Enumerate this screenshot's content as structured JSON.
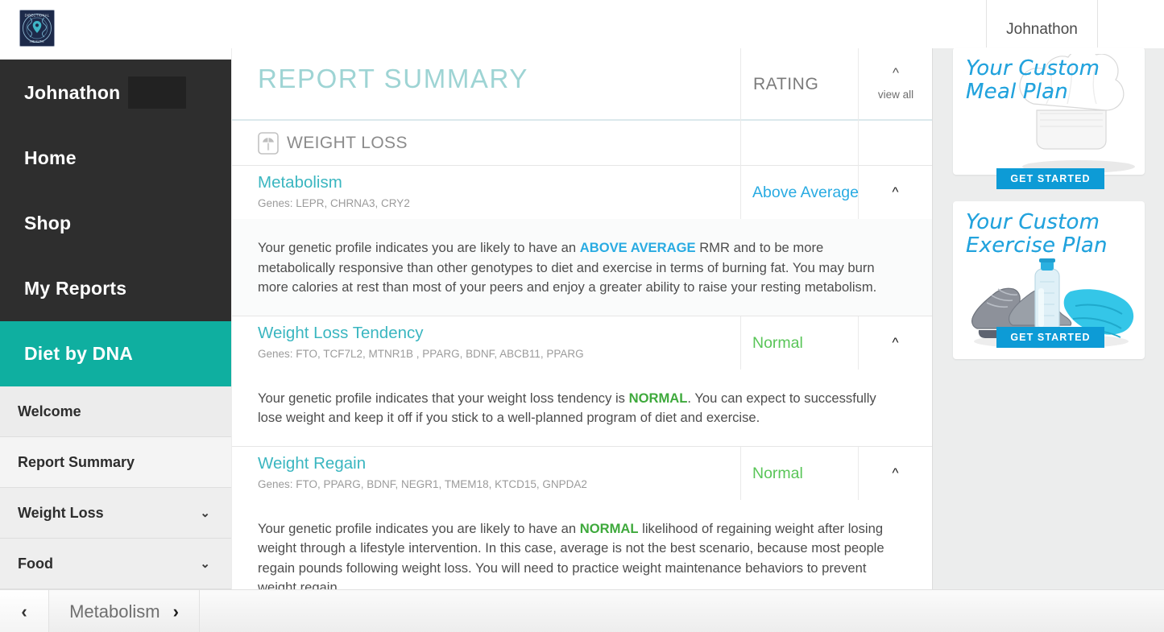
{
  "topbar": {
    "logo_alt": "DIRECTIONAL HEALTH",
    "logo_text_top": "DIRECTIONAL",
    "logo_text_bottom": "HEALTH",
    "user_name": "Johnathon"
  },
  "sidebar": {
    "user_name": "Johnathon",
    "primary_items": [
      {
        "label": "Home",
        "active": false
      },
      {
        "label": "Shop",
        "active": false
      },
      {
        "label": "My Reports",
        "active": false
      },
      {
        "label": "Diet by DNA",
        "active": true
      }
    ],
    "sub_items": [
      {
        "label": "Welcome",
        "chevron": ""
      },
      {
        "label": "Report Summary",
        "chevron": ""
      },
      {
        "label": "Weight Loss",
        "chevron": "⌄"
      },
      {
        "label": "Food",
        "chevron": "⌄"
      }
    ]
  },
  "main": {
    "title": "REPORT SUMMARY",
    "rating_column_header": "RATING",
    "view_all_label": "view all",
    "collapse_icon": "^",
    "category": {
      "label": "WEIGHT LOSS",
      "icon": "scale-icon"
    },
    "entries": [
      {
        "name": "Metabolism",
        "genes_label": "Genes: LEPR, CHRNA3, CRY2",
        "rating": "Above Average",
        "rating_color": "#29abe2",
        "toggle_icon": "^",
        "body_pre": "Your genetic profile indicates you are likely to have an ",
        "body_highlight": "ABOVE AVERAGE",
        "body_post": " RMR and to be more metabolically responsive than other genotypes to diet and exercise in terms of burning fat. You may burn more calories at rest than most of your peers and enjoy a greater ability to raise your resting metabolism."
      },
      {
        "name": "Weight Loss Tendency",
        "genes_label": "Genes: FTO, TCF7L2, MTNR1B , PPARG, BDNF, ABCB11, PPARG",
        "rating": "Normal",
        "rating_color": "#59c558",
        "toggle_icon": "^",
        "body_pre": "Your genetic profile indicates that your weight loss tendency is ",
        "body_highlight": "NORMAL",
        "body_post": ". You can expect to successfully lose weight and keep it off if you stick to a well-planned program of diet and exercise."
      },
      {
        "name": "Weight Regain",
        "genes_label": "Genes: FTO, PPARG, BDNF, NEGR1, TMEM18, KTCD15, GNPDA2",
        "rating": "Normal",
        "rating_color": "#59c558",
        "toggle_icon": "^",
        "body_pre": "Your genetic profile indicates you are likely to have an ",
        "body_highlight": "NORMAL",
        "body_post": " likelihood of regaining weight after losing weight through a lifestyle intervention. In this case, average is not the best scenario, because most people regain pounds following weight loss. You will need to practice weight maintenance behaviors to prevent weight regain."
      }
    ]
  },
  "rail": {
    "promos": [
      {
        "title_line1": "Your Custom",
        "title_line2": "Meal Plan",
        "cta": "GET STARTED",
        "art": "chef-hat-image"
      },
      {
        "title_line1": "Your Custom",
        "title_line2": "Exercise Plan",
        "cta": "GET STARTED",
        "art": "running-shoes-water-towel-image"
      }
    ]
  },
  "pager": {
    "prev_icon": "‹",
    "current_label": "Metabolism",
    "next_icon": "›"
  },
  "colors": {
    "sidebar_bg": "#2e2e2e",
    "accent_teal": "#0fafa0",
    "title_teal": "#9ed4d4",
    "entry_name_teal": "#3ab6c0",
    "rating_blue": "#29abe2",
    "rating_green": "#59c558",
    "promo_blue": "#0d9bd6"
  }
}
